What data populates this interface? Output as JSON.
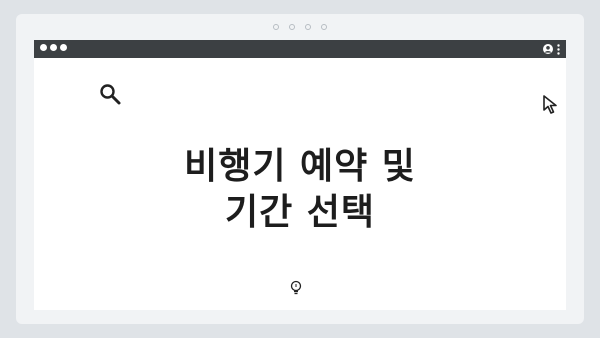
{
  "headline": {
    "line1": "비행기 예약 및",
    "line2": "기간 선택"
  },
  "icons": {
    "search": "search-icon",
    "cursor": "cursor-icon",
    "user": "user-icon",
    "menu": "kebab-menu-icon",
    "bulb": "lightbulb-icon"
  },
  "colors": {
    "titlebar": "#3c4043",
    "background": "#dfe3e7",
    "text": "#1d1d1d"
  }
}
